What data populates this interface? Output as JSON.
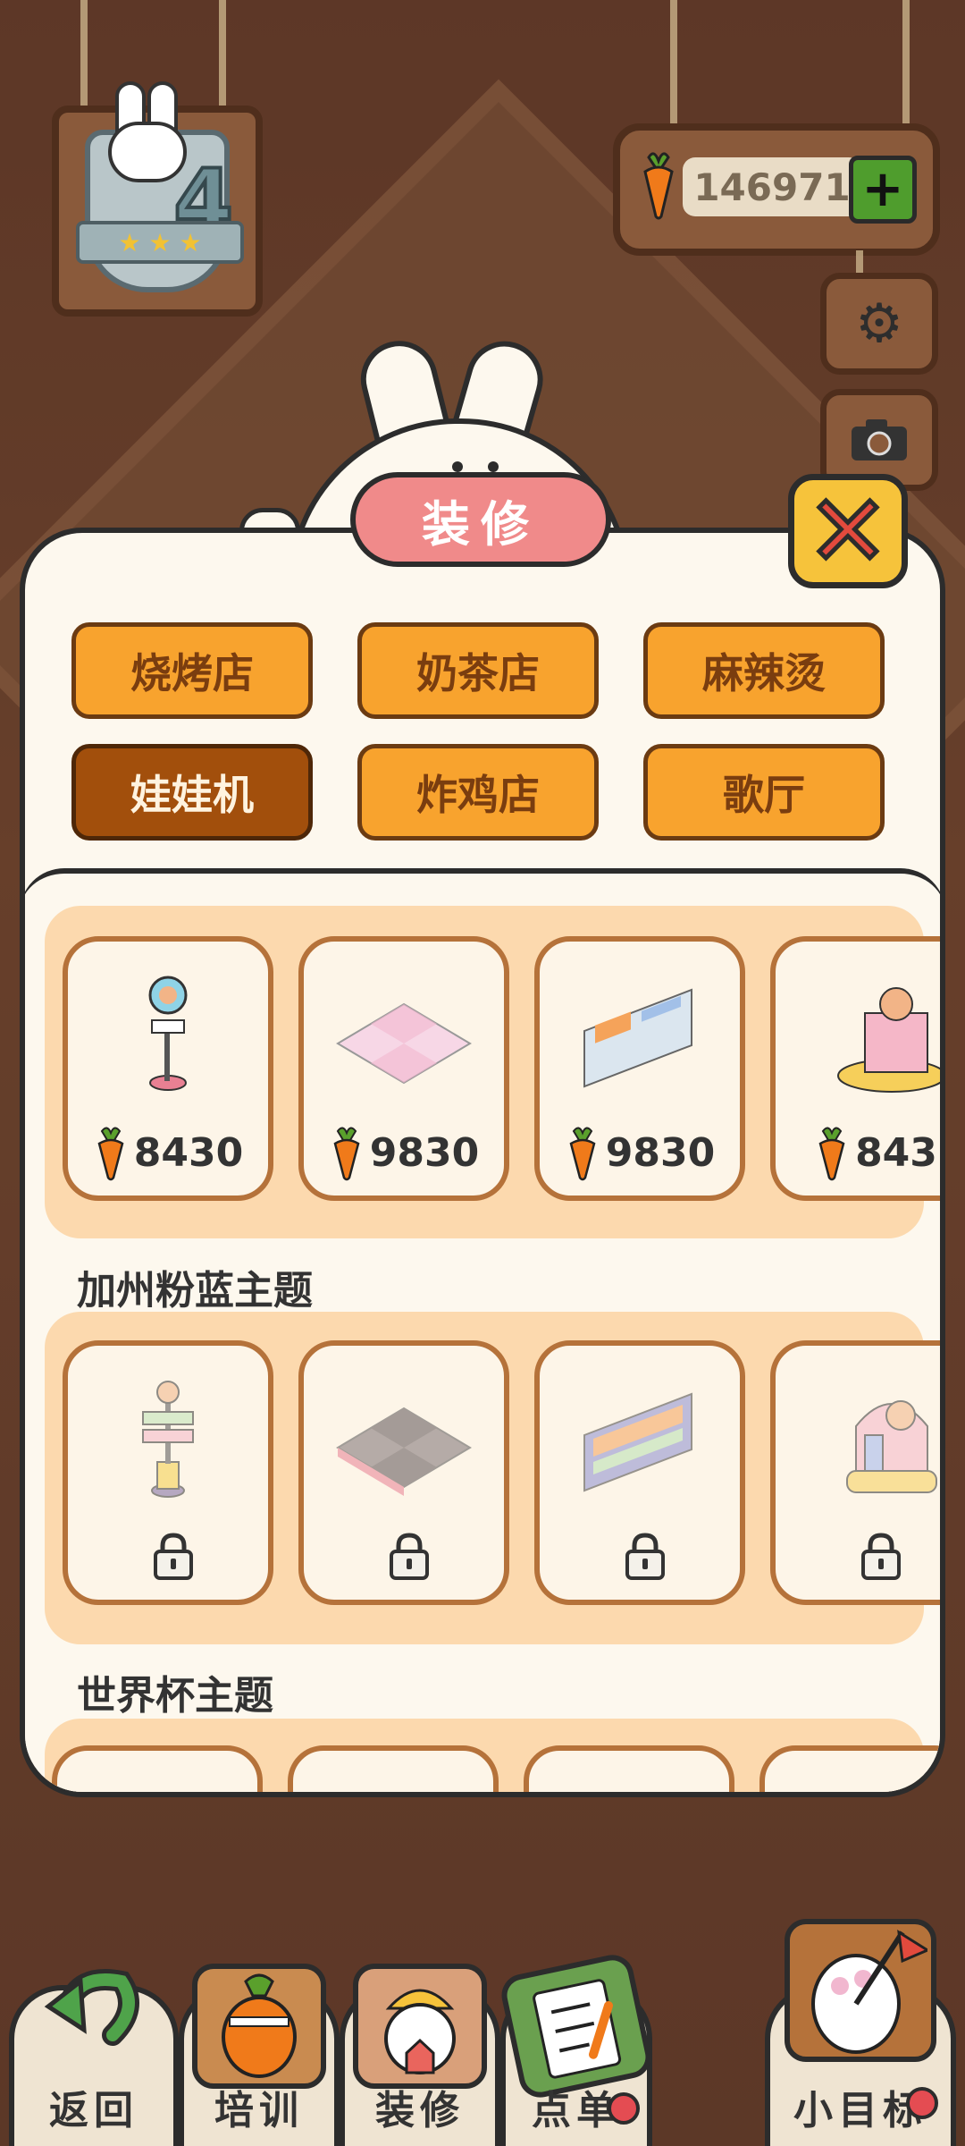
{
  "header": {
    "level": "4",
    "currency_amount": "146971",
    "add_currency_label": "+"
  },
  "modal": {
    "title": "装修",
    "categories": [
      "烧烤店",
      "奶茶店",
      "麻辣烫",
      "娃娃机",
      "炸鸡店",
      "歌厅"
    ],
    "active_category": "娃娃机",
    "sections": [
      {
        "title": "",
        "items": [
          {
            "name": "sign-stand",
            "price": "8430"
          },
          {
            "name": "checker-floor",
            "price": "9830"
          },
          {
            "name": "wall-panel",
            "price": "9830"
          },
          {
            "name": "cake-stage",
            "price": "843"
          }
        ]
      },
      {
        "title": "加州粉蓝主题",
        "items": [
          {
            "name": "direction-sign",
            "locked": true
          },
          {
            "name": "dark-floor",
            "locked": true
          },
          {
            "name": "wall-screen",
            "locked": true
          },
          {
            "name": "arch-stage",
            "locked": true
          }
        ]
      },
      {
        "title": "世界杯主题",
        "items": []
      }
    ]
  },
  "bottom_nav": {
    "items": [
      {
        "label": "返回",
        "icon": "back-arrow-icon"
      },
      {
        "label": "培训",
        "icon": "carrot-trainer-icon"
      },
      {
        "label": "装修",
        "icon": "builder-bunny-icon"
      },
      {
        "label": "点单",
        "icon": "order-clipboard-icon"
      },
      {
        "label": "小目标",
        "icon": "goal-flag-icon"
      }
    ]
  },
  "colors": {
    "accent_orange": "#f8a32e",
    "active_tab": "#a24f0c",
    "title_pink": "#f08a8a",
    "close_yellow": "#f6c33b"
  }
}
